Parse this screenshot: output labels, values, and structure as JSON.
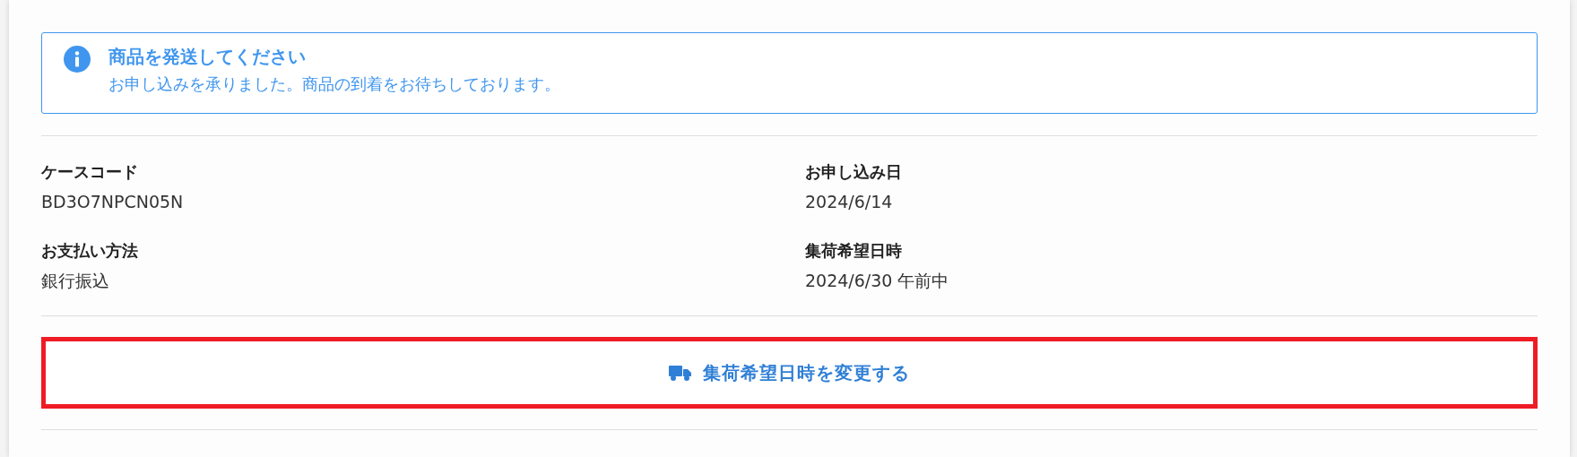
{
  "notice": {
    "kind": "info",
    "title": "商品を発送してください",
    "message": "お申し込みを承りました。商品の到着をお待ちしております。"
  },
  "details": [
    {
      "label": "ケースコード",
      "value": "BD3O7NPCN05N"
    },
    {
      "label": "お申し込み日",
      "value": "2024/6/14"
    },
    {
      "label": "お支払い方法",
      "value": "銀行振込"
    },
    {
      "label": "集荷希望日時",
      "value": "2024/6/30 午前中"
    }
  ],
  "action": {
    "label": "集荷希望日時を変更する",
    "highlighted": true
  }
}
